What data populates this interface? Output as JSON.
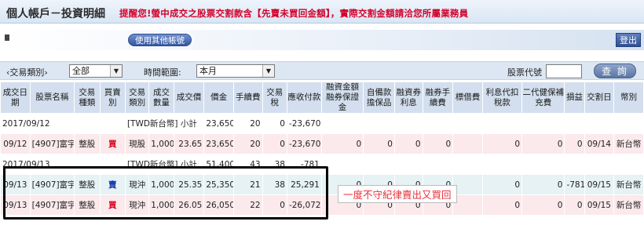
{
  "header": {
    "title": "個人帳戶－投資明細",
    "notice": "提醒您!螢中成交之股票交割款含【先賣未買回金額】，實際交割金額請洽您所屬業務員"
  },
  "account": {
    "switch_label": "使用其他帳號",
    "logout_label": "登出"
  },
  "filters": {
    "trade_type_label": "‹交易類別›",
    "trade_type_value": "全部",
    "time_range_label": "時間範圍:",
    "time_range_value": "本月",
    "stock_code_label": "股票代號",
    "stock_code_value": "",
    "query_label": "查 詢"
  },
  "columns": [
    "成交日期",
    "股票名稱",
    "交易種類",
    "買賣別",
    "交易類別",
    "成交數量",
    "成交價",
    "價金",
    "手續費",
    "交易稅",
    "應收付款",
    "融資金額融券保證金",
    "自備款擔保品",
    "融資券利息",
    "融券手續費",
    "標借費",
    "利息代扣稅款",
    "二代健保補充費",
    "損益",
    "交割日",
    "幣別"
  ],
  "rows": [
    {
      "kind": "sub",
      "date": "2017/09/12",
      "label": "[TWD新台幣] 小計",
      "amount": "23,650",
      "fee": "20",
      "tax": "0",
      "net": "-23,670"
    },
    {
      "kind": "detail",
      "date": "09/12",
      "stock": "[4907]富宇",
      "type": "整股",
      "side": "買",
      "category": "現股",
      "qty": "1,000",
      "price": "23.65",
      "amount": "23,650",
      "fee": "20",
      "tax": "0",
      "net": "-23,670",
      "margin": "0",
      "collateral": "0",
      "interest": "0",
      "short_fee": "0",
      "borrow_fee": "",
      "withhold": "0",
      "nhi": "0",
      "pnl": "0",
      "settle": "09/14",
      "currency": "新台幣"
    },
    {
      "kind": "sub",
      "date": "2017/09/13",
      "label": "[TWD新台幣] 小計",
      "amount": "51,400",
      "fee": "43",
      "tax": "38",
      "net": "-781"
    },
    {
      "kind": "detail-alt",
      "date": "09/13",
      "stock": "[4907]富宇",
      "type": "整股",
      "side": "賣",
      "category": "現沖",
      "qty": "1,000",
      "price": "25.35",
      "amount": "25,350",
      "fee": "21",
      "tax": "38",
      "net": "25,291",
      "margin": "0",
      "collateral": "0",
      "interest": "0",
      "short_fee": "0",
      "borrow_fee": "",
      "withhold": "0",
      "nhi": "0",
      "pnl": "-781",
      "settle": "09/15",
      "currency": "新台幣"
    },
    {
      "kind": "detail",
      "date": "09/13",
      "stock": "[4907]富宇",
      "type": "整股",
      "side": "買",
      "category": "現沖",
      "qty": "1,000",
      "price": "26.05",
      "amount": "26,050",
      "fee": "22",
      "tax": "0",
      "net": "-26,072",
      "margin": "0",
      "collateral": "0",
      "interest": "0",
      "short_fee": "0",
      "borrow_fee": "",
      "withhold": "0",
      "nhi": "0",
      "pnl": "0",
      "settle": "09/15",
      "currency": "新台幣"
    }
  ],
  "annotation": "一度不守紀律賣出又買回",
  "colors": {
    "buy": "#d8001a",
    "sell": "#1b3fae",
    "notice": "#d4002a",
    "annotation": "#e8323c"
  }
}
